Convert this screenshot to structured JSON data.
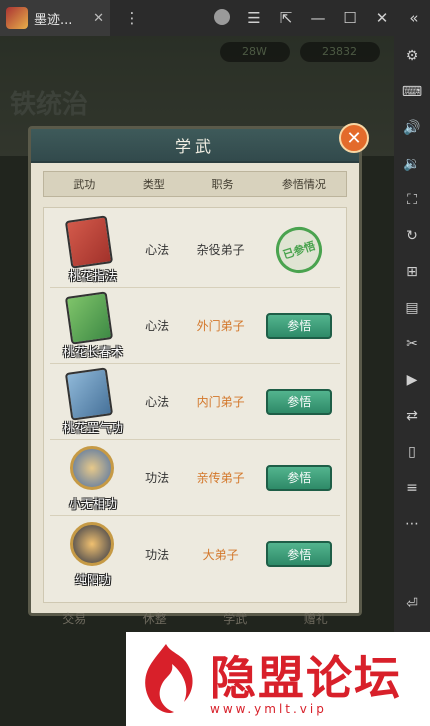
{
  "window": {
    "tab_title": "墨迹...",
    "tab_close": "✕"
  },
  "game_bg": {
    "res_a": "28W",
    "res_b": "23832",
    "banner": "铁统治"
  },
  "dialog": {
    "title": "学武",
    "close": "✕",
    "columns": [
      "武功",
      "类型",
      "职务",
      "参悟情况"
    ],
    "rows": [
      {
        "name": "桃花指法",
        "type": "心法",
        "role": "杂役弟子",
        "status": "已参悟"
      },
      {
        "name": "桃花长春术",
        "type": "心法",
        "role": "外门弟子",
        "action": "参悟"
      },
      {
        "name": "桃花罡气功",
        "type": "心法",
        "role": "内门弟子",
        "action": "参悟"
      },
      {
        "name": "小无相功",
        "type": "功法",
        "role": "亲传弟子",
        "action": "参悟"
      },
      {
        "name": "纯阳功",
        "type": "功法",
        "role": "大弟子",
        "action": "参悟"
      }
    ]
  },
  "bottom_tabs": [
    "交易",
    "休整",
    "学武",
    "赠礼"
  ],
  "watermark": {
    "title": "隐盟论坛",
    "url": "www.ymlt.vip"
  }
}
